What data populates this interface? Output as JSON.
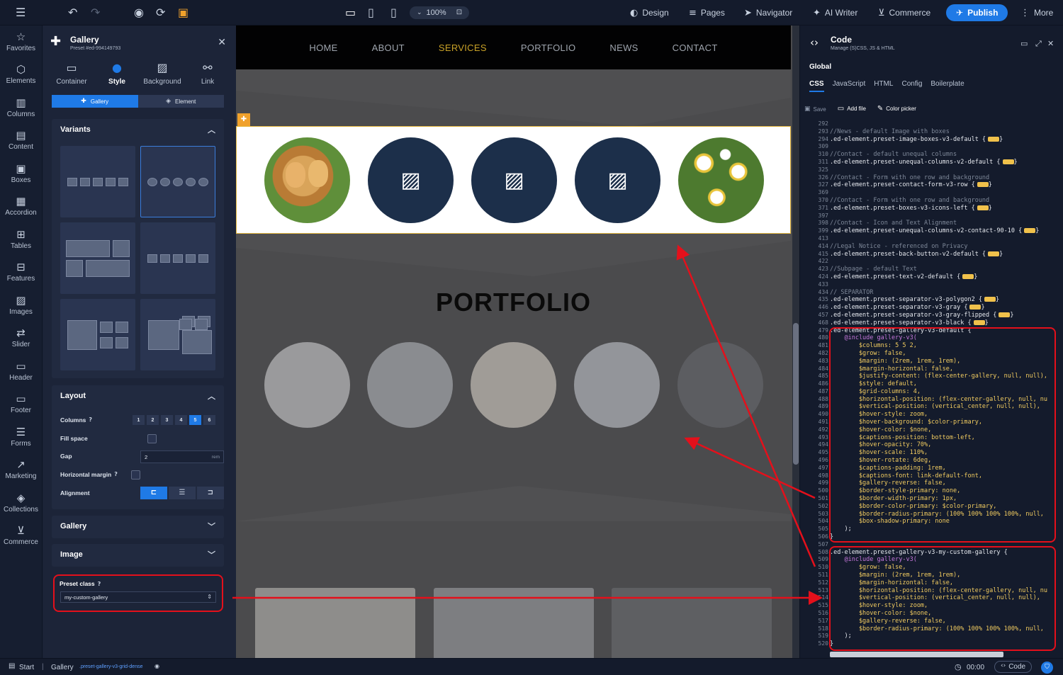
{
  "topbar": {
    "zoom": "100%",
    "design": "Design",
    "pages": "Pages",
    "navigator": "Navigator",
    "ai_writer": "AI Writer",
    "commerce": "Commerce",
    "publish": "Publish",
    "more": "More"
  },
  "sidebar": {
    "items": [
      "Favorites",
      "Elements",
      "Columns",
      "Content",
      "Boxes",
      "Accordion",
      "Tables",
      "Features",
      "Images",
      "Slider",
      "Header",
      "Footer",
      "Forms",
      "Marketing",
      "Collections",
      "Commerce"
    ]
  },
  "panel": {
    "title": "Gallery",
    "subtitle": "Preset #ed-994149793",
    "tabs": [
      "Container",
      "Style",
      "Background",
      "Link"
    ],
    "seg": [
      "Gallery",
      "Element"
    ],
    "variants_title": "Variants",
    "layout_title": "Layout",
    "columns_label": "Columns",
    "columns": [
      "1",
      "2",
      "3",
      "4",
      "5",
      "6"
    ],
    "fill_label": "Fill space",
    "gap_label": "Gap",
    "gap_value": "2",
    "gap_unit": "rem",
    "hmargin_label": "Horizontal margin",
    "align_label": "Alignment",
    "gallery_title": "Gallery",
    "image_title": "Image",
    "preset_label": "Preset class",
    "preset_value": "my-custom-gallery"
  },
  "canvas": {
    "nav": [
      "HOME",
      "ABOUT",
      "SERVICES",
      "PORTFOLIO",
      "NEWS",
      "CONTACT"
    ],
    "portfolio_title": "PORTFOLIO"
  },
  "code": {
    "title": "Code",
    "subtitle": "Manage (S)CSS, JS & HTML",
    "scope": "Global",
    "tabs": [
      "CSS",
      "JavaScript",
      "HTML",
      "Config",
      "Boilerplate"
    ],
    "save": "Save",
    "add_file": "Add file",
    "color_picker": "Color picker",
    "line_numbers": [
      "292",
      "293",
      "294",
      "309",
      "310",
      "311",
      "325",
      "326",
      "327",
      "369",
      "370",
      "371",
      "397",
      "398",
      "399",
      "413",
      "414",
      "415",
      "422",
      "423",
      "424",
      "433",
      "434",
      "435",
      "446",
      "457",
      "468",
      "479",
      "480",
      "481",
      "482",
      "483",
      "484",
      "485",
      "486",
      "487",
      "488",
      "489",
      "490",
      "491",
      "492",
      "493",
      "494",
      "495",
      "496",
      "497",
      "498",
      "499",
      "500",
      "501",
      "502",
      "503",
      "504",
      "505",
      "506",
      "507",
      "508",
      "509",
      "510",
      "511",
      "512",
      "513",
      "514",
      "515",
      "516",
      "517",
      "518",
      "519",
      "520"
    ],
    "lines": [
      "",
      "//News - default Image with boxes",
      ".ed-element.preset-image-boxes-v3-default {",
      "",
      "//Contact - default unequal columns",
      ".ed-element.preset-unequal-columns-v2-default {",
      "",
      "//Contact - Form with one row and background",
      ".ed-element.preset-contact-form-v3-row {",
      "",
      "//Contact - Form with one row and background",
      ".ed-element.preset-boxes-v3-icons-left {",
      "",
      "//Contact - Icon and Text Alignment",
      ".ed-element.preset-unequal-columns-v2-contact-90-10 {",
      "",
      "//Legal Notice - referenced on Privacy",
      ".ed-element.preset-back-button-v2-default {",
      "",
      "//Subpage - default Text",
      ".ed-element.preset-text-v2-default {",
      "",
      "// SEPARATOR",
      ".ed-element.preset-separator-v3-polygon2 {",
      ".ed-element.preset-separator-v3-gray {",
      ".ed-element.preset-separator-v3-gray-flipped {",
      ".ed-element.preset-separator-v3-black {",
      ".ed-element.preset-gallery-v3-default {",
      "    @include gallery-v3(",
      "        $columns: 5 5 2,",
      "        $grow: false,",
      "        $margin: (2rem, 1rem, 1rem),",
      "        $margin-horizontal: false,",
      "        $justify-content: (flex-center-gallery, null, null),",
      "        $style: default,",
      "        $grid-columns: 4,",
      "        $horizontal-position: (flex-center-gallery, null, nu",
      "        $vertical-position: (vertical_center, null, null),",
      "        $hover-style: zoom,",
      "        $hover-background: $color-primary,",
      "        $hover-color: $none,",
      "        $captions-position: bottom-left,",
      "        $hover-opacity: 70%,",
      "        $hover-scale: 110%,",
      "        $hover-rotate: 6deg,",
      "        $captions-padding: 1rem,",
      "        $captions-font: link-default-font,",
      "        $gallery-reverse: false,",
      "        $border-style-primary: none,",
      "        $border-width-primary: 1px,",
      "        $border-color-primary: $color-primary,",
      "        $border-radius-primary: (100% 100% 100% 100%, null,",
      "        $box-shadow-primary: none",
      "    );",
      "}",
      "",
      ".ed-element.preset-gallery-v3-my-custom-gallery {",
      "    @include gallery-v3(",
      "        $grow: false,",
      "        $margin: (2rem, 1rem, 1rem),",
      "        $margin-horizontal: false,",
      "        $horizontal-position: (flex-center-gallery, null, nu",
      "        $vertical-position: (vertical_center, null, null),",
      "        $hover-style: zoom,",
      "        $hover-color: $none,",
      "        $gallery-reverse: false,",
      "        $border-radius-primary: (100% 100% 100% 100%, null,",
      "    );",
      "}"
    ]
  },
  "status": {
    "start": "Start",
    "crumb": "Gallery",
    "preset": ".preset-gallery-v3-grid-dense",
    "time": "00:00",
    "code": "Code"
  },
  "colors": {
    "accent": "#1f7ae6",
    "annotation": "#e4101b",
    "active_nav": "#c9a227"
  }
}
